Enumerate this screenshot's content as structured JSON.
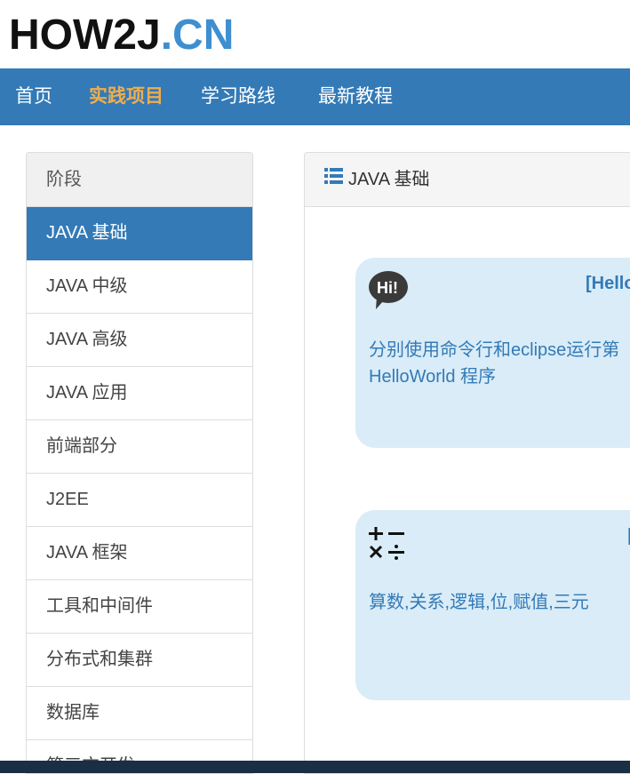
{
  "logo": {
    "part1": "HOW2J",
    "part2": ".CN"
  },
  "nav": {
    "items": [
      {
        "label": "首页"
      },
      {
        "label": "实践项目"
      },
      {
        "label": "学习路线"
      },
      {
        "label": "最新教程"
      }
    ]
  },
  "sidebar": {
    "heading": "阶段",
    "items": [
      {
        "label": "JAVA 基础"
      },
      {
        "label": "JAVA 中级"
      },
      {
        "label": "JAVA 高级"
      },
      {
        "label": "JAVA 应用"
      },
      {
        "label": "前端部分"
      },
      {
        "label": "J2EE"
      },
      {
        "label": "JAVA 框架"
      },
      {
        "label": "工具和中间件"
      },
      {
        "label": "分布式和集群"
      },
      {
        "label": "数据库"
      },
      {
        "label": "第三方开发"
      }
    ]
  },
  "panel": {
    "title": "JAVA 基础",
    "icon": "list-icon",
    "cards": [
      {
        "icon": "hi-speech-bubble-icon",
        "title": "[Hello",
        "description": "分别使用命令行和eclipse运行第",
        "description_line2": "HelloWorld 程序"
      },
      {
        "icon": "math-operators-icon",
        "title": "[",
        "description": "算数,关系,逻辑,位,赋值,三元"
      }
    ]
  },
  "colors": {
    "navbar": "#337ab7",
    "active_nav": "#f0ad4e",
    "card_bg": "#d9ecf7",
    "accent": "#337ab7"
  }
}
